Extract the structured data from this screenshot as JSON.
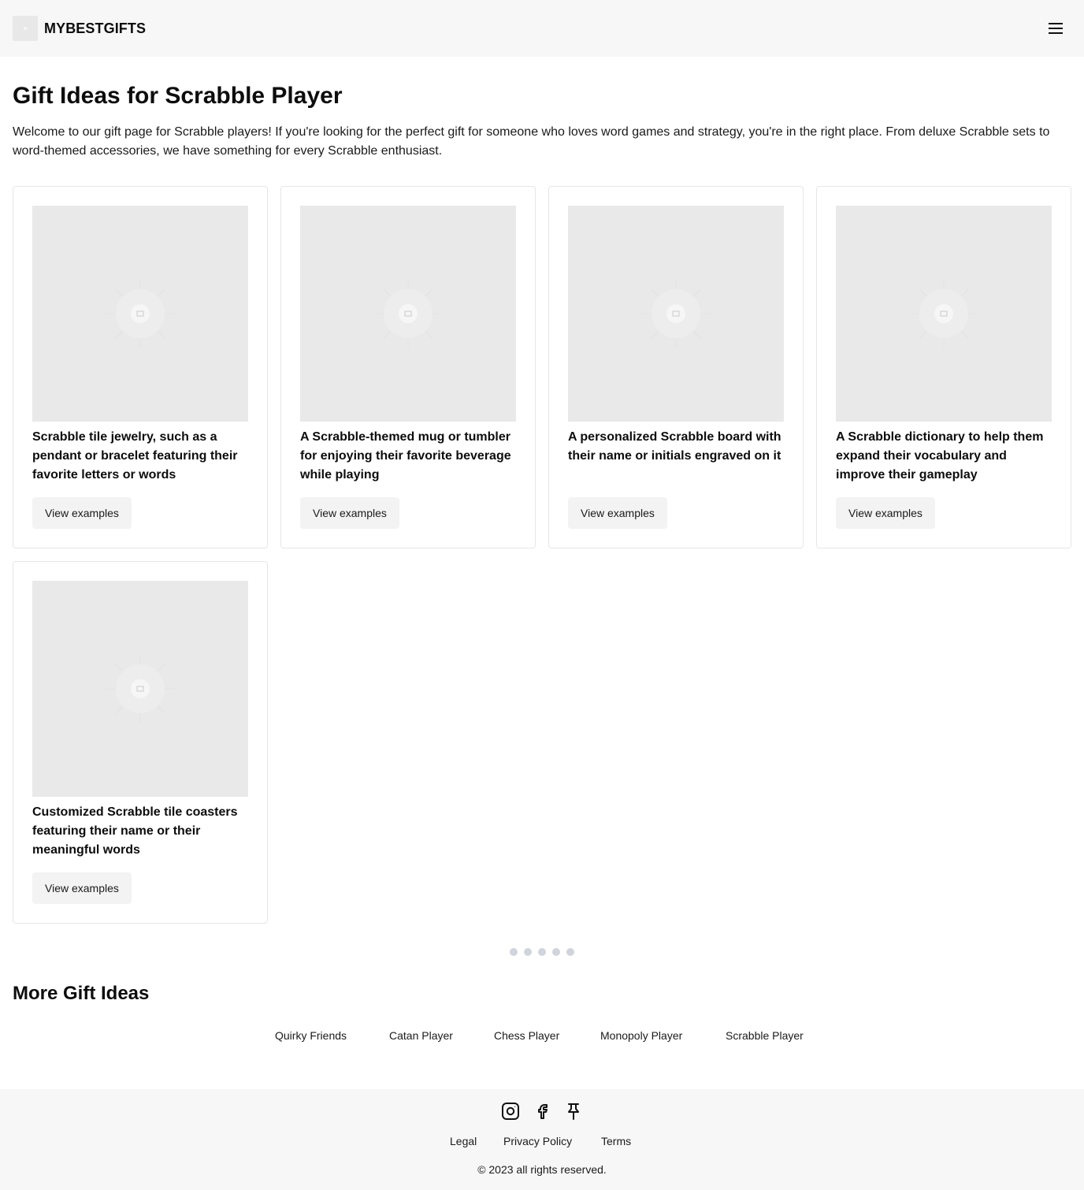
{
  "header": {
    "brand": "MYBESTGIFTS",
    "menu_icon": "hamburger-menu-icon"
  },
  "hero": {
    "title": "Gift Ideas for Scrabble Player",
    "intro": "Welcome to our gift page for Scrabble players! If you're looking for the perfect gift for someone who loves word games and strategy, you're in the right place. From deluxe Scrabble sets to word-themed accessories, we have something for every Scrabble enthusiast."
  },
  "cards": [
    {
      "title": "Scrabble tile jewelry, such as a pendant or bracelet featuring their favorite letters or words",
      "button": "View examples"
    },
    {
      "title": "A Scrabble-themed mug or tumbler for enjoying their favorite beverage while playing",
      "button": "View examples"
    },
    {
      "title": "A personalized Scrabble board with their name or initials engraved on it",
      "button": "View examples"
    },
    {
      "title": "A Scrabble dictionary to help them expand their vocabulary and improve their gameplay",
      "button": "View examples"
    },
    {
      "title": "Customized Scrabble tile coasters featuring their name or their meaningful words",
      "button": "View examples"
    }
  ],
  "pagination": {
    "dot_count": 5,
    "dot_color": "#d1d5db"
  },
  "more": {
    "title": "More Gift Ideas",
    "links": [
      "Quirky Friends",
      "Catan Player",
      "Chess Player",
      "Monopoly Player",
      "Scrabble Player"
    ]
  },
  "footer": {
    "social_icons": [
      "instagram-icon",
      "facebook-icon",
      "pinterest-icon"
    ],
    "links": [
      "Legal",
      "Privacy Policy",
      "Terms"
    ],
    "copyright": "© 2023 all rights reserved."
  }
}
